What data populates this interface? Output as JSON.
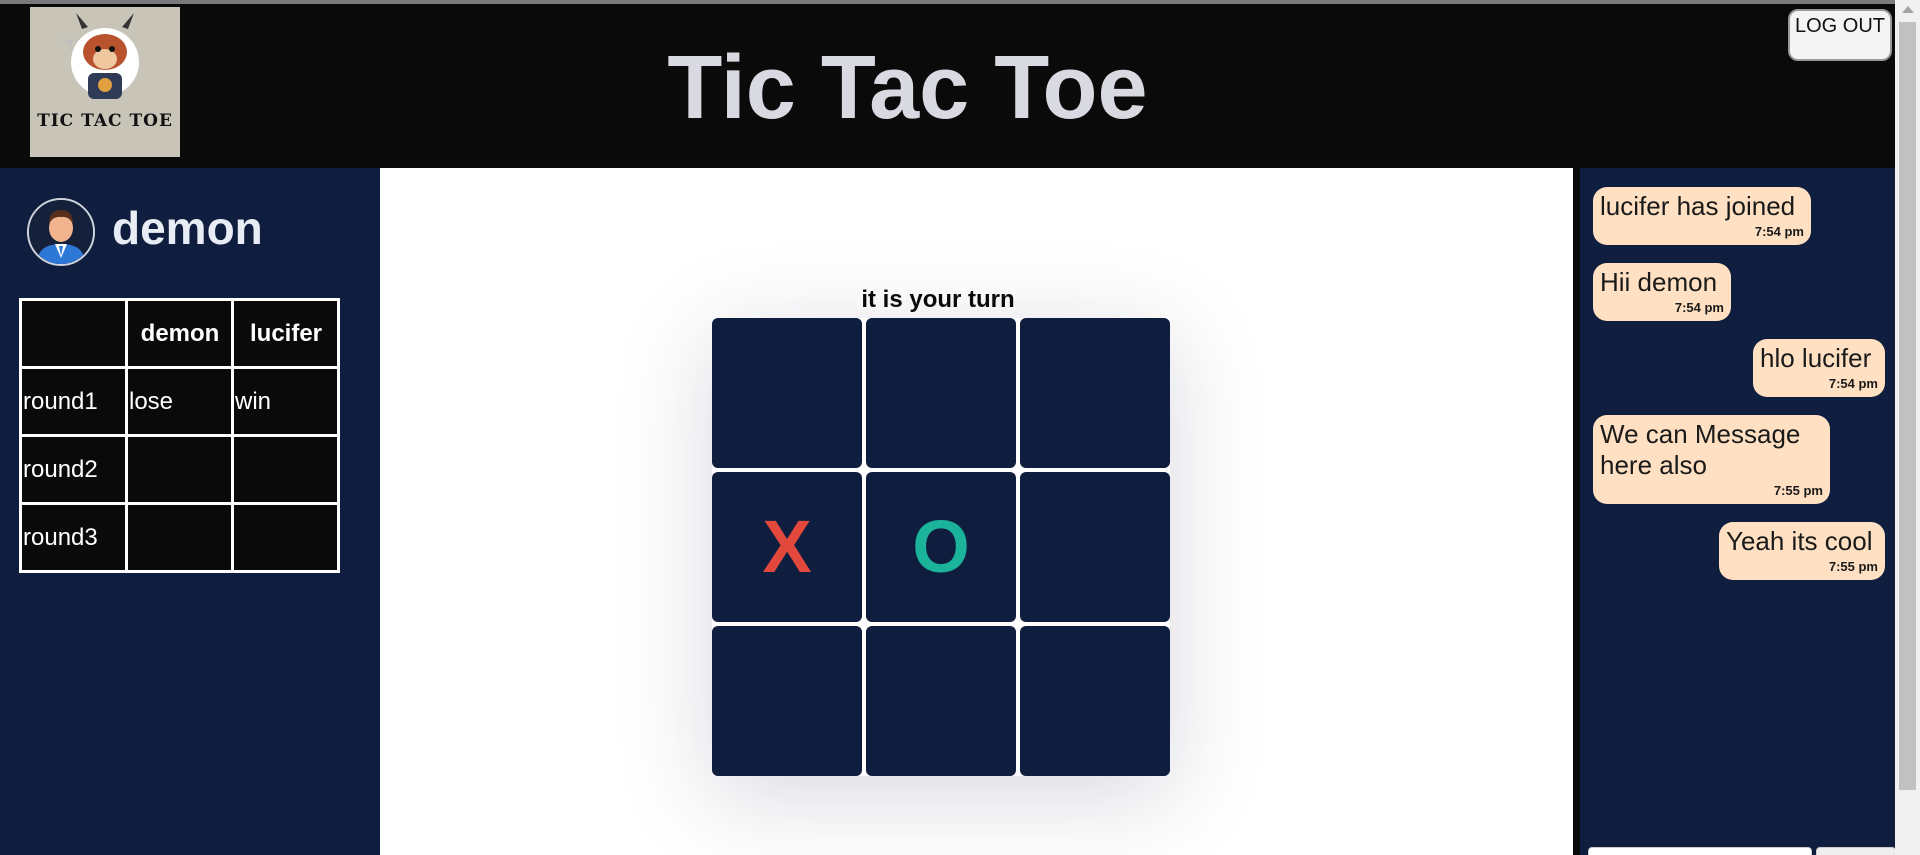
{
  "header": {
    "logo_text": "TIC TAC TOE",
    "title": "Tic Tac Toe",
    "logout_label": "LOG OUT"
  },
  "player": {
    "name": "demon"
  },
  "scoreboard": {
    "headers": [
      "",
      "demon",
      "lucifer"
    ],
    "rows": [
      [
        "round1",
        "lose",
        "win"
      ],
      [
        "round2",
        "",
        ""
      ],
      [
        "round3",
        "",
        ""
      ]
    ]
  },
  "game": {
    "turn_text": "it is your turn",
    "board": [
      "",
      "",
      "",
      "X",
      "O",
      "",
      "",
      "",
      ""
    ],
    "x_color": "#e2483c",
    "o_color": "#1bb39a"
  },
  "chat": {
    "messages": [
      {
        "text": "lucifer has joined",
        "time": "7:54 pm",
        "side": "left"
      },
      {
        "text": "Hii demon",
        "time": "7:54 pm",
        "side": "left"
      },
      {
        "text": "hlo lucifer",
        "time": "7:54 pm",
        "side": "right"
      },
      {
        "text": "We can Message here also",
        "time": "7:55 pm",
        "side": "left"
      },
      {
        "text": "Yeah its cool",
        "time": "7:55 pm",
        "side": "right"
      }
    ]
  },
  "colors": {
    "panel": "#0f1e3e",
    "header": "#0a0a0a",
    "bubble": "#ffe0c2"
  }
}
